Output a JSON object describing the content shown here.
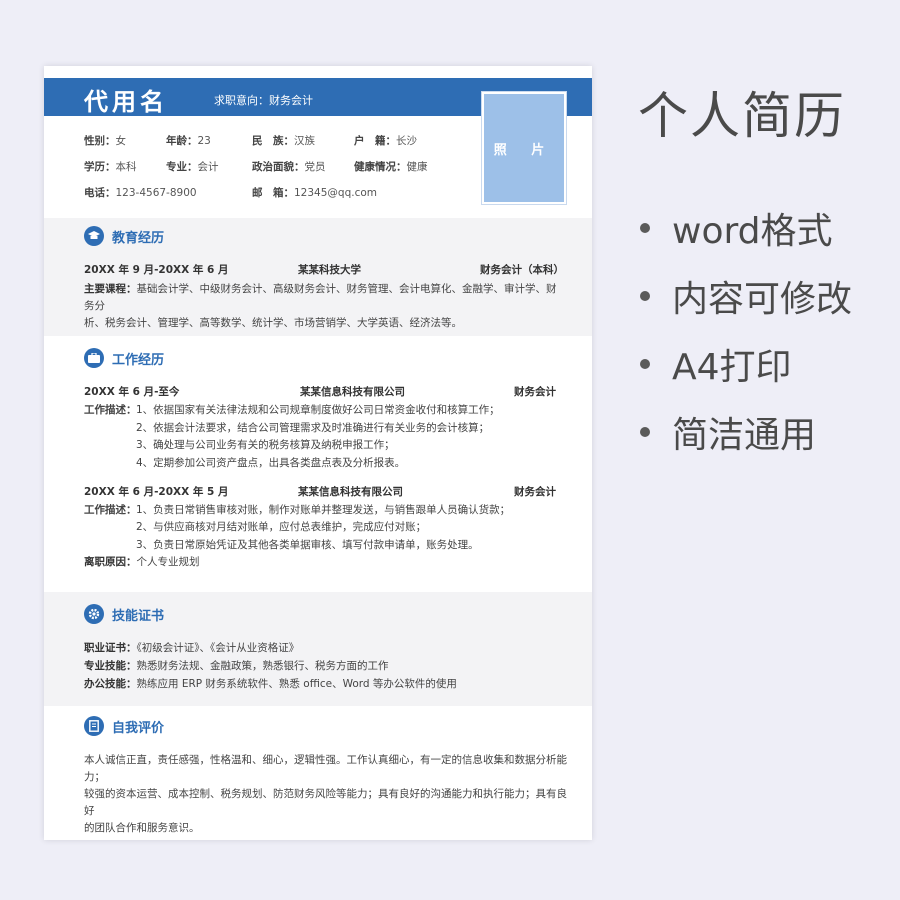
{
  "resume": {
    "name": "代用名",
    "intent": "求职意向：财务会计",
    "photo_label": "照 片",
    "info": {
      "gender": {
        "k": "性别：",
        "v": "女"
      },
      "age": {
        "k": "年龄：",
        "v": "23"
      },
      "ethnicity": {
        "k": "民　族：",
        "v": "汉族"
      },
      "hukou": {
        "k": "户　籍：",
        "v": "长沙"
      },
      "education": {
        "k": "学历：",
        "v": "本科"
      },
      "major": {
        "k": "专业：",
        "v": "会计"
      },
      "politics": {
        "k": "政治面貌：",
        "v": "党员"
      },
      "health": {
        "k": "健康情况：",
        "v": "健康"
      },
      "phone": {
        "k": "电话：",
        "v": "123-4567-8900"
      },
      "email": {
        "k": "邮　箱：",
        "v": "12345@qq.com"
      }
    },
    "education_section": {
      "title": "教育经历",
      "period": "20XX 年 9 月-20XX 年 6 月",
      "school": "某某科技大学",
      "degree": "财务会计（本科）",
      "courses_key": "主要课程：",
      "courses_line1": "基础会计学、中级财务会计、高级财务会计、财务管理、会计电算化、金融学、审计学、财务分",
      "courses_line2": "析、税务会计、管理学、高等数学、统计学、市场营销学、大学英语、经济法等。"
    },
    "work_section": {
      "title": "工作经历",
      "job1": {
        "period": "20XX 年 6 月-至今",
        "company": "某某信息科技有限公司",
        "role": "财务会计",
        "desc_key": "工作描述：",
        "items": [
          "1、依据国家有关法律法规和公司规章制度做好公司日常资金收付和核算工作；",
          "2、依据会计法要求，结合公司管理需求及时准确进行有关业务的会计核算；",
          "3、确处理与公司业务有关的税务核算及纳税申报工作；",
          "4、定期参加公司资产盘点，出具各类盘点表及分析报表。"
        ]
      },
      "job2": {
        "period": "20XX 年 6 月-20XX 年 5 月",
        "company": "某某信息科技有限公司",
        "role": "财务会计",
        "desc_key": "工作描述：",
        "items": [
          "1、负责日常销售审核对账，制作对账单并整理发送，与销售跟单人员确认货款；",
          "2、与供应商核对月结对账单，应付总表维护，完成应付对账；",
          "3、负责日常原始凭证及其他各类单据审核、填写付款申请单，账务处理。"
        ],
        "leave_key": "离职原因：",
        "leave_reason": "个人专业规划"
      }
    },
    "skills_section": {
      "title": "技能证书",
      "cert_key": "职业证书：",
      "cert": "《初级会计证》、《会计从业资格证》",
      "pro_key": "专业技能：",
      "pro": "熟悉财务法规、金融政策，熟悉银行、税务方面的工作",
      "office_key": "办公技能：",
      "office": "熟练应用 ERP 财务系统软件、熟悉 office、Word 等办公软件的使用"
    },
    "self_section": {
      "title": "自我评价",
      "line1": "本人诚信正直，责任感强，性格温和、细心，逻辑性强。工作认真细心，有一定的信息收集和数据分析能力；",
      "line2": "较强的资本运营、成本控制、税务规划、防范财务风险等能力；具有良好的沟通能力和执行能力；具有良好",
      "line3": "的团队合作和服务意识。"
    }
  },
  "promo": {
    "title": "个人简历",
    "bullets": [
      "word格式",
      "内容可修改",
      "A4打印",
      "简洁通用"
    ]
  },
  "colors": {
    "accent": "#2e6db4",
    "photo": "#9dc0e8",
    "section_bg": "#f3f3f5"
  }
}
